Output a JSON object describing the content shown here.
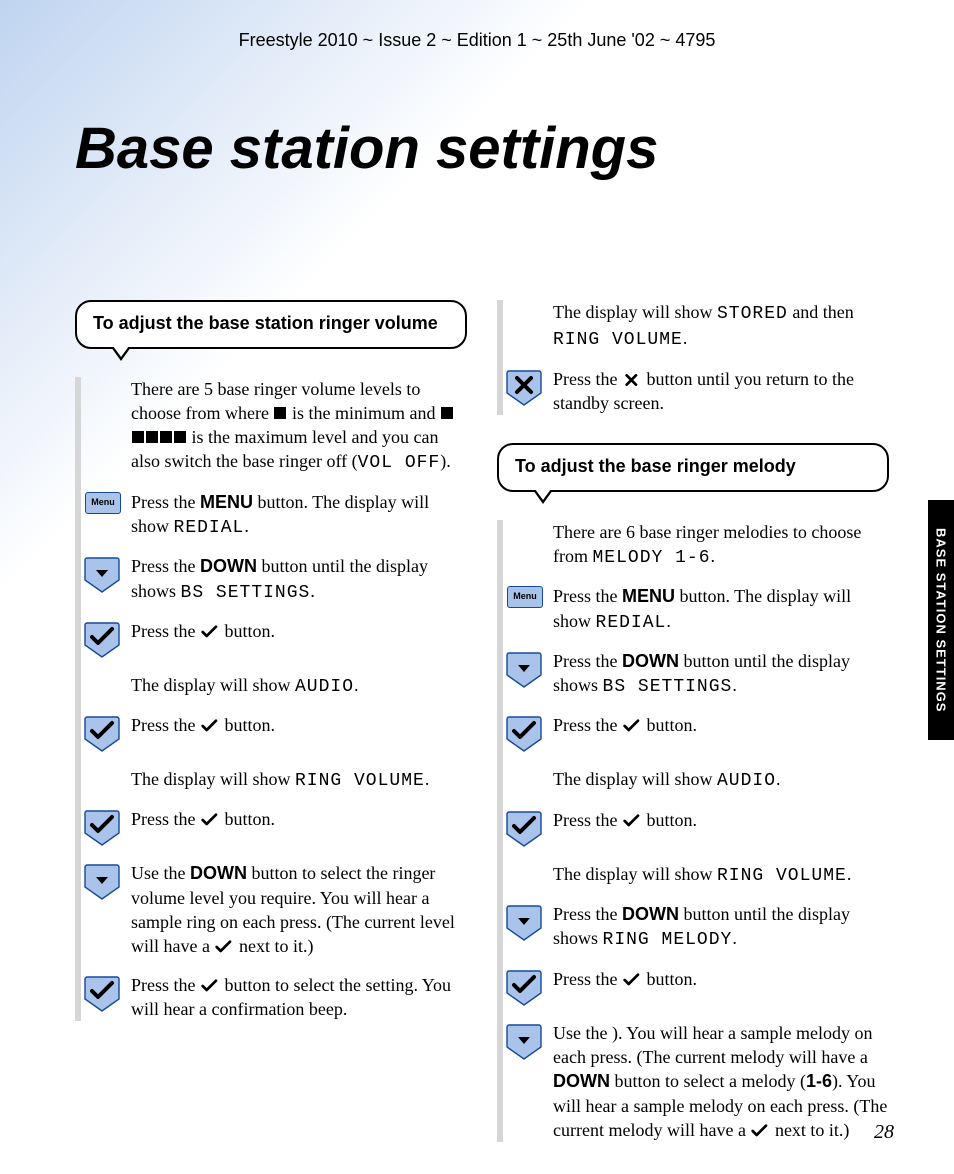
{
  "header": "Freestyle 2010 ~ Issue 2 ~ Edition 1 ~ 25th June '02 ~ 4795",
  "title": "Base station settings",
  "side_tab": "BASE STATION SETTINGS",
  "page_number": "28",
  "icon_labels": {
    "menu": "Menu"
  },
  "left": {
    "callout": "To adjust the base station ringer volume",
    "steps": [
      {
        "icon": "none",
        "pre": "There are 5 base ringer volume levels to choose from where ",
        "mid1": "[SQ1]",
        "mid2": " is the minimum and ",
        "mid3": "[SQ5]",
        "mid4": " is the maximum level and you can also switch the base ringer off (",
        "mono": "VOL OFF",
        "post": ")."
      },
      {
        "icon": "menu",
        "pre": "Press the ",
        "bold": "MENU",
        "mid": " button. The display will show ",
        "mono": "REDIAL",
        "post": "."
      },
      {
        "icon": "down",
        "pre": "Press the ",
        "bold": "DOWN",
        "mid": " button until the display shows ",
        "mono": "BS SETTINGS",
        "post": "."
      },
      {
        "icon": "tick",
        "pre": "Press the ",
        "glyph": "tick",
        "post": " button."
      },
      {
        "icon": "none",
        "pre": "The display will show ",
        "mono": "AUDIO",
        "post": "."
      },
      {
        "icon": "tick",
        "pre": "Press the ",
        "glyph": "tick",
        "post": " button."
      },
      {
        "icon": "none",
        "pre": "The display will show ",
        "mono": "RING VOLUME",
        "post": "."
      },
      {
        "icon": "tick",
        "pre": "Press the ",
        "glyph": "tick",
        "post": " button."
      },
      {
        "icon": "down",
        "pre": "Use the ",
        "bold": "DOWN",
        "mid": " button to select the ringer volume level you require. You will hear a sample ring on each press. (The current level will have a ",
        "glyph": "tick",
        "post": " next to it.)"
      },
      {
        "icon": "tick",
        "pre": "Press the ",
        "glyph": "tick",
        "post": " button to select the setting. You will hear a confirmation beep."
      }
    ]
  },
  "right": {
    "pre_steps": [
      {
        "icon": "none",
        "pre": "The display will show ",
        "mono": "STORED",
        "mid": " and then ",
        "mono2": "RING VOLUME",
        "post": "."
      },
      {
        "icon": "cross",
        "pre": "Press the ",
        "glyph": "cross",
        "post": " button until you return to the standby screen."
      }
    ],
    "callout": "To adjust the base ringer melody",
    "steps": [
      {
        "icon": "none",
        "pre": "There are 6 base ringer melodies to choose from ",
        "mono": "MELODY 1-6",
        "post": "."
      },
      {
        "icon": "menu",
        "pre": "Press the ",
        "bold": "MENU",
        "mid": " button.  The display will show ",
        "mono": "REDIAL",
        "post": "."
      },
      {
        "icon": "down",
        "pre": "Press the ",
        "bold": "DOWN",
        "mid": " button until the display shows ",
        "mono": "BS SETTINGS",
        "post": "."
      },
      {
        "icon": "tick",
        "pre": "Press the ",
        "glyph": "tick",
        "post": " button."
      },
      {
        "icon": "none",
        "pre": "The display will show ",
        "mono": "AUDIO",
        "post": "."
      },
      {
        "icon": "tick",
        "pre": "Press the ",
        "glyph": "tick",
        "post": " button."
      },
      {
        "icon": "none",
        "pre": "The display will show ",
        "mono": "RING VOLUME",
        "post": "."
      },
      {
        "icon": "down",
        "pre": "Press the ",
        "bold": "DOWN",
        "mid": " button until the display shows ",
        "mono": "RING MELODY",
        "post": "."
      },
      {
        "icon": "tick",
        "pre": "Press the ",
        "glyph": "tick",
        "post": " button."
      },
      {
        "icon": "down",
        "pre": "Use the ",
        "bold": "DOWN",
        "mid": " button to select a melody (",
        "bold2": "1-6",
        "mid2": "). You will hear a sample melody on each press. (The current melody will have a ",
        "glyph": "tick",
        "post": " next to it.)"
      }
    ]
  }
}
